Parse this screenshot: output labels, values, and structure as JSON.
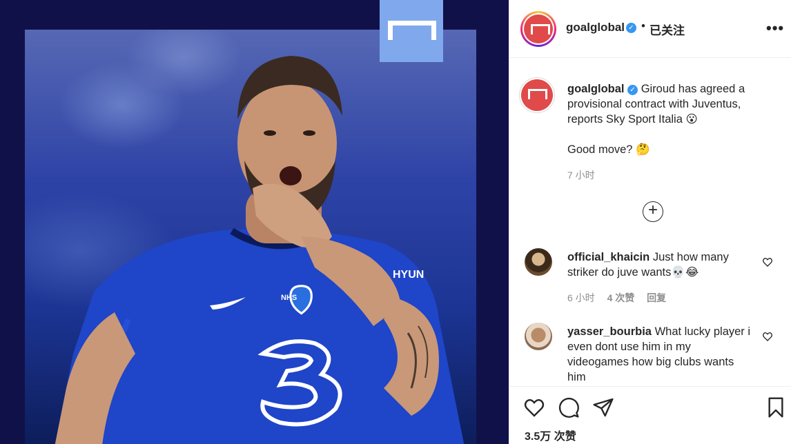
{
  "post": {
    "username": "goalglobal",
    "follow_status": "已关注",
    "header_separator": "•",
    "more_label": "•••",
    "caption_line": "Giroud has agreed a provisional contract with Juventus, reports Sky Sport Italia 😮",
    "caption_question": "Good move? 🤔",
    "time": "7 小时",
    "load_more_label": "+",
    "views": "3.5万 次赞"
  },
  "comments": [
    {
      "username": "official_khaicin",
      "text": "Just how many striker do juve wants💀😂",
      "time": "6 小时",
      "likes": "4 次赞",
      "reply": "回复"
    },
    {
      "username": "yasser_bourbia",
      "text": "What lucky player i even dont use him in my videogames how big clubs wants him"
    }
  ],
  "colors": {
    "brand": "#e04a4a",
    "verified": "#3897f0",
    "media_bg": "#11114a",
    "logo_tab": "#7fa9ec"
  },
  "icons": [
    "goal-logo-icon",
    "verified-icon",
    "more-icon",
    "load-more-icon",
    "heart-icon",
    "comment-icon",
    "share-icon",
    "save-icon"
  ]
}
